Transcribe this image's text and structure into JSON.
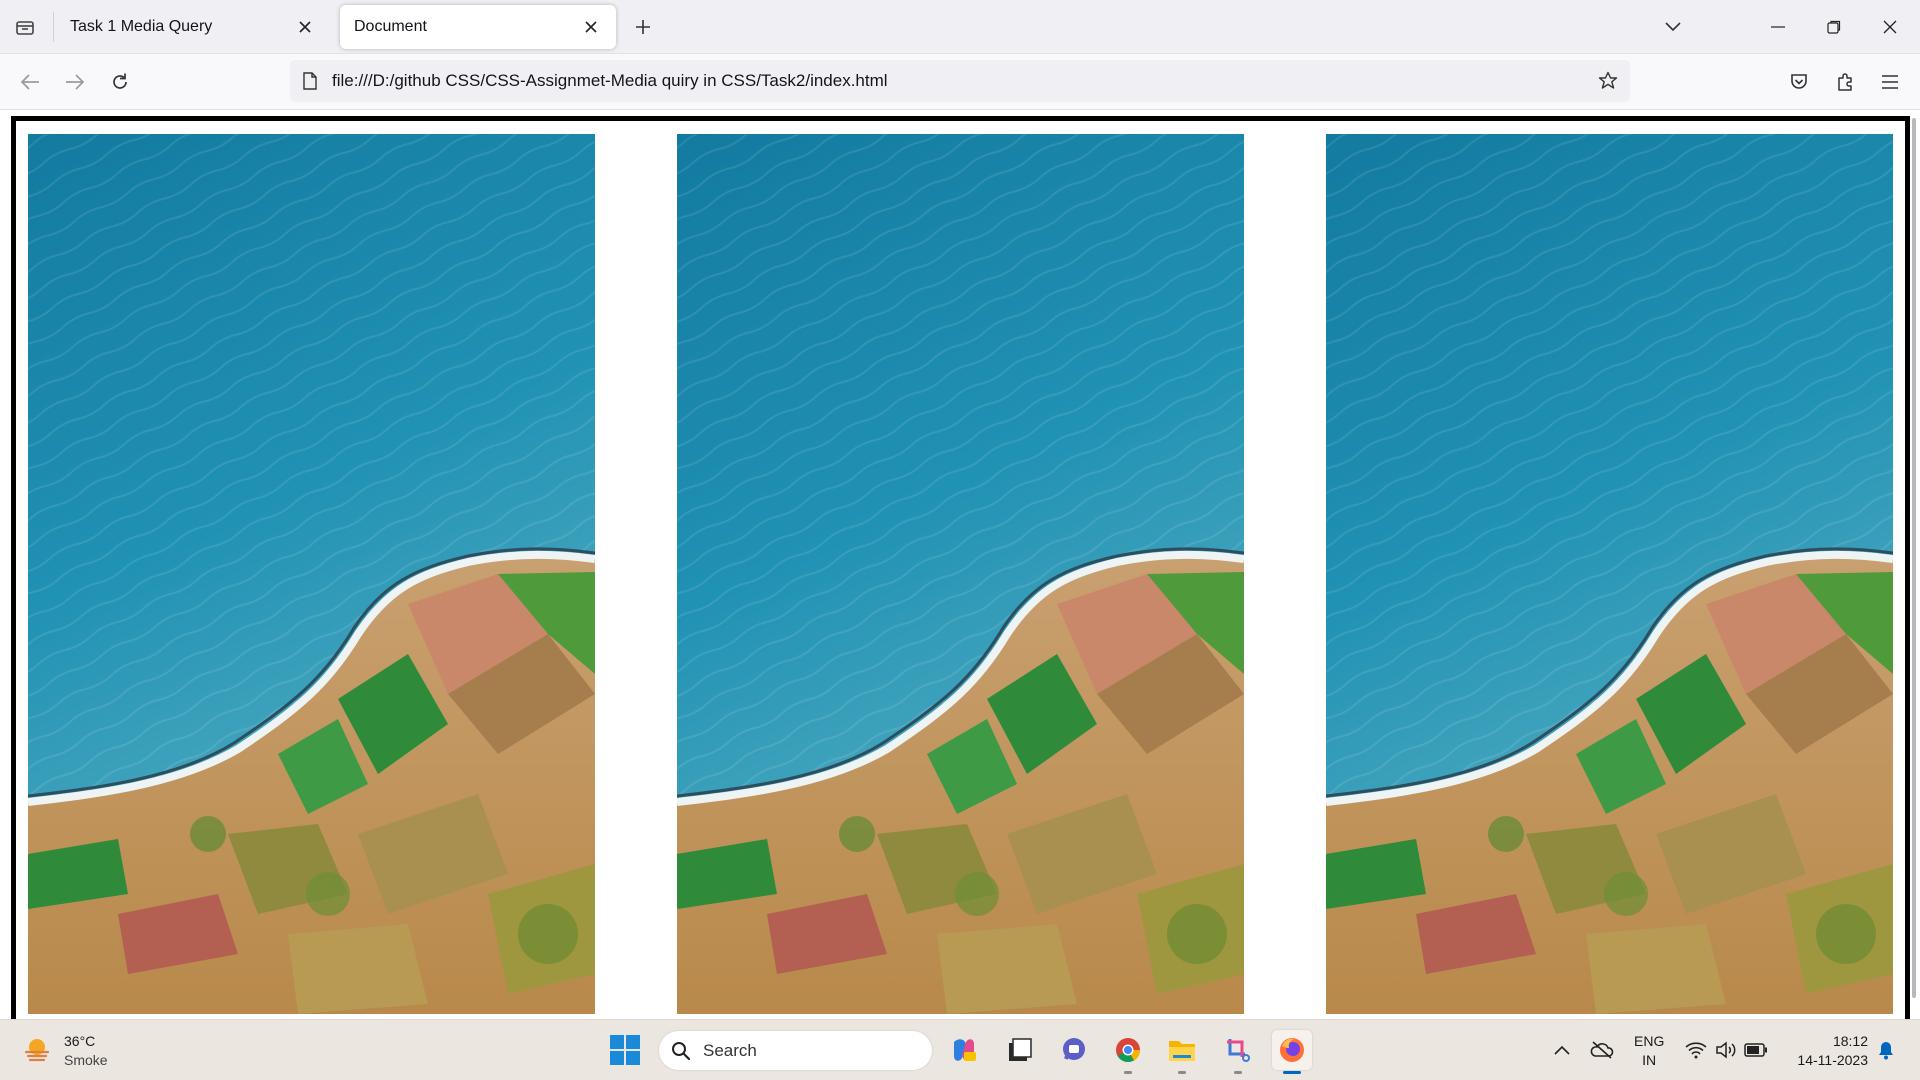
{
  "browser": {
    "tabs": [
      {
        "title": "Task 1 Media Query",
        "active": false
      },
      {
        "title": "Document",
        "active": true
      }
    ],
    "url": "file:///D:/github CSS/CSS-Assignmet-Media quiry in CSS/Task2/index.html"
  },
  "page": {
    "images": [
      {
        "subject": "aerial coastline photo"
      },
      {
        "subject": "aerial coastline photo"
      },
      {
        "subject": "aerial coastline photo"
      }
    ]
  },
  "taskbar": {
    "weather": {
      "temp": "36°C",
      "desc": "Smoke"
    },
    "search_label": "Search",
    "lang": {
      "line1": "ENG",
      "line2": "IN"
    },
    "clock": {
      "time": "18:12",
      "date": "14-11-2023"
    }
  },
  "colors": {
    "accent": "#0067c0",
    "sea": "#1f86a8",
    "land": "#c49a64"
  }
}
